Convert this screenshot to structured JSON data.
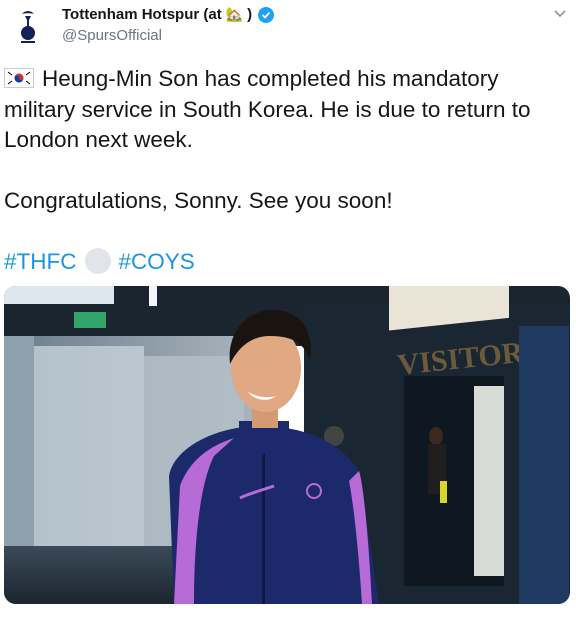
{
  "account": {
    "display_name": "Tottenham Hotspur (at",
    "name_suffix": ")",
    "house_emoji": "🏡",
    "handle": "@SpursOfficial"
  },
  "icons": {
    "avatar": "spurs-cockerel-logo",
    "verified": "verified-badge-icon",
    "menu": "chevron-down-icon",
    "flag": "south-korea-flag-emoji"
  },
  "tweet": {
    "line1": "Heung-Min Son has completed his mandatory",
    "line2": "military service in South Korea. He is due to return to",
    "line3": "London next week.",
    "line4": "Congratulations, Sonny. See you soon!",
    "hashtag1": "#THFC",
    "hashtag2": "#COYS"
  },
  "media": {
    "sign_text": "VISITORS"
  },
  "colors": {
    "link": "#1b95e0",
    "verified": "#1da1f2",
    "jacket": "#1c2a6b",
    "stripe": "#b76bd6"
  }
}
